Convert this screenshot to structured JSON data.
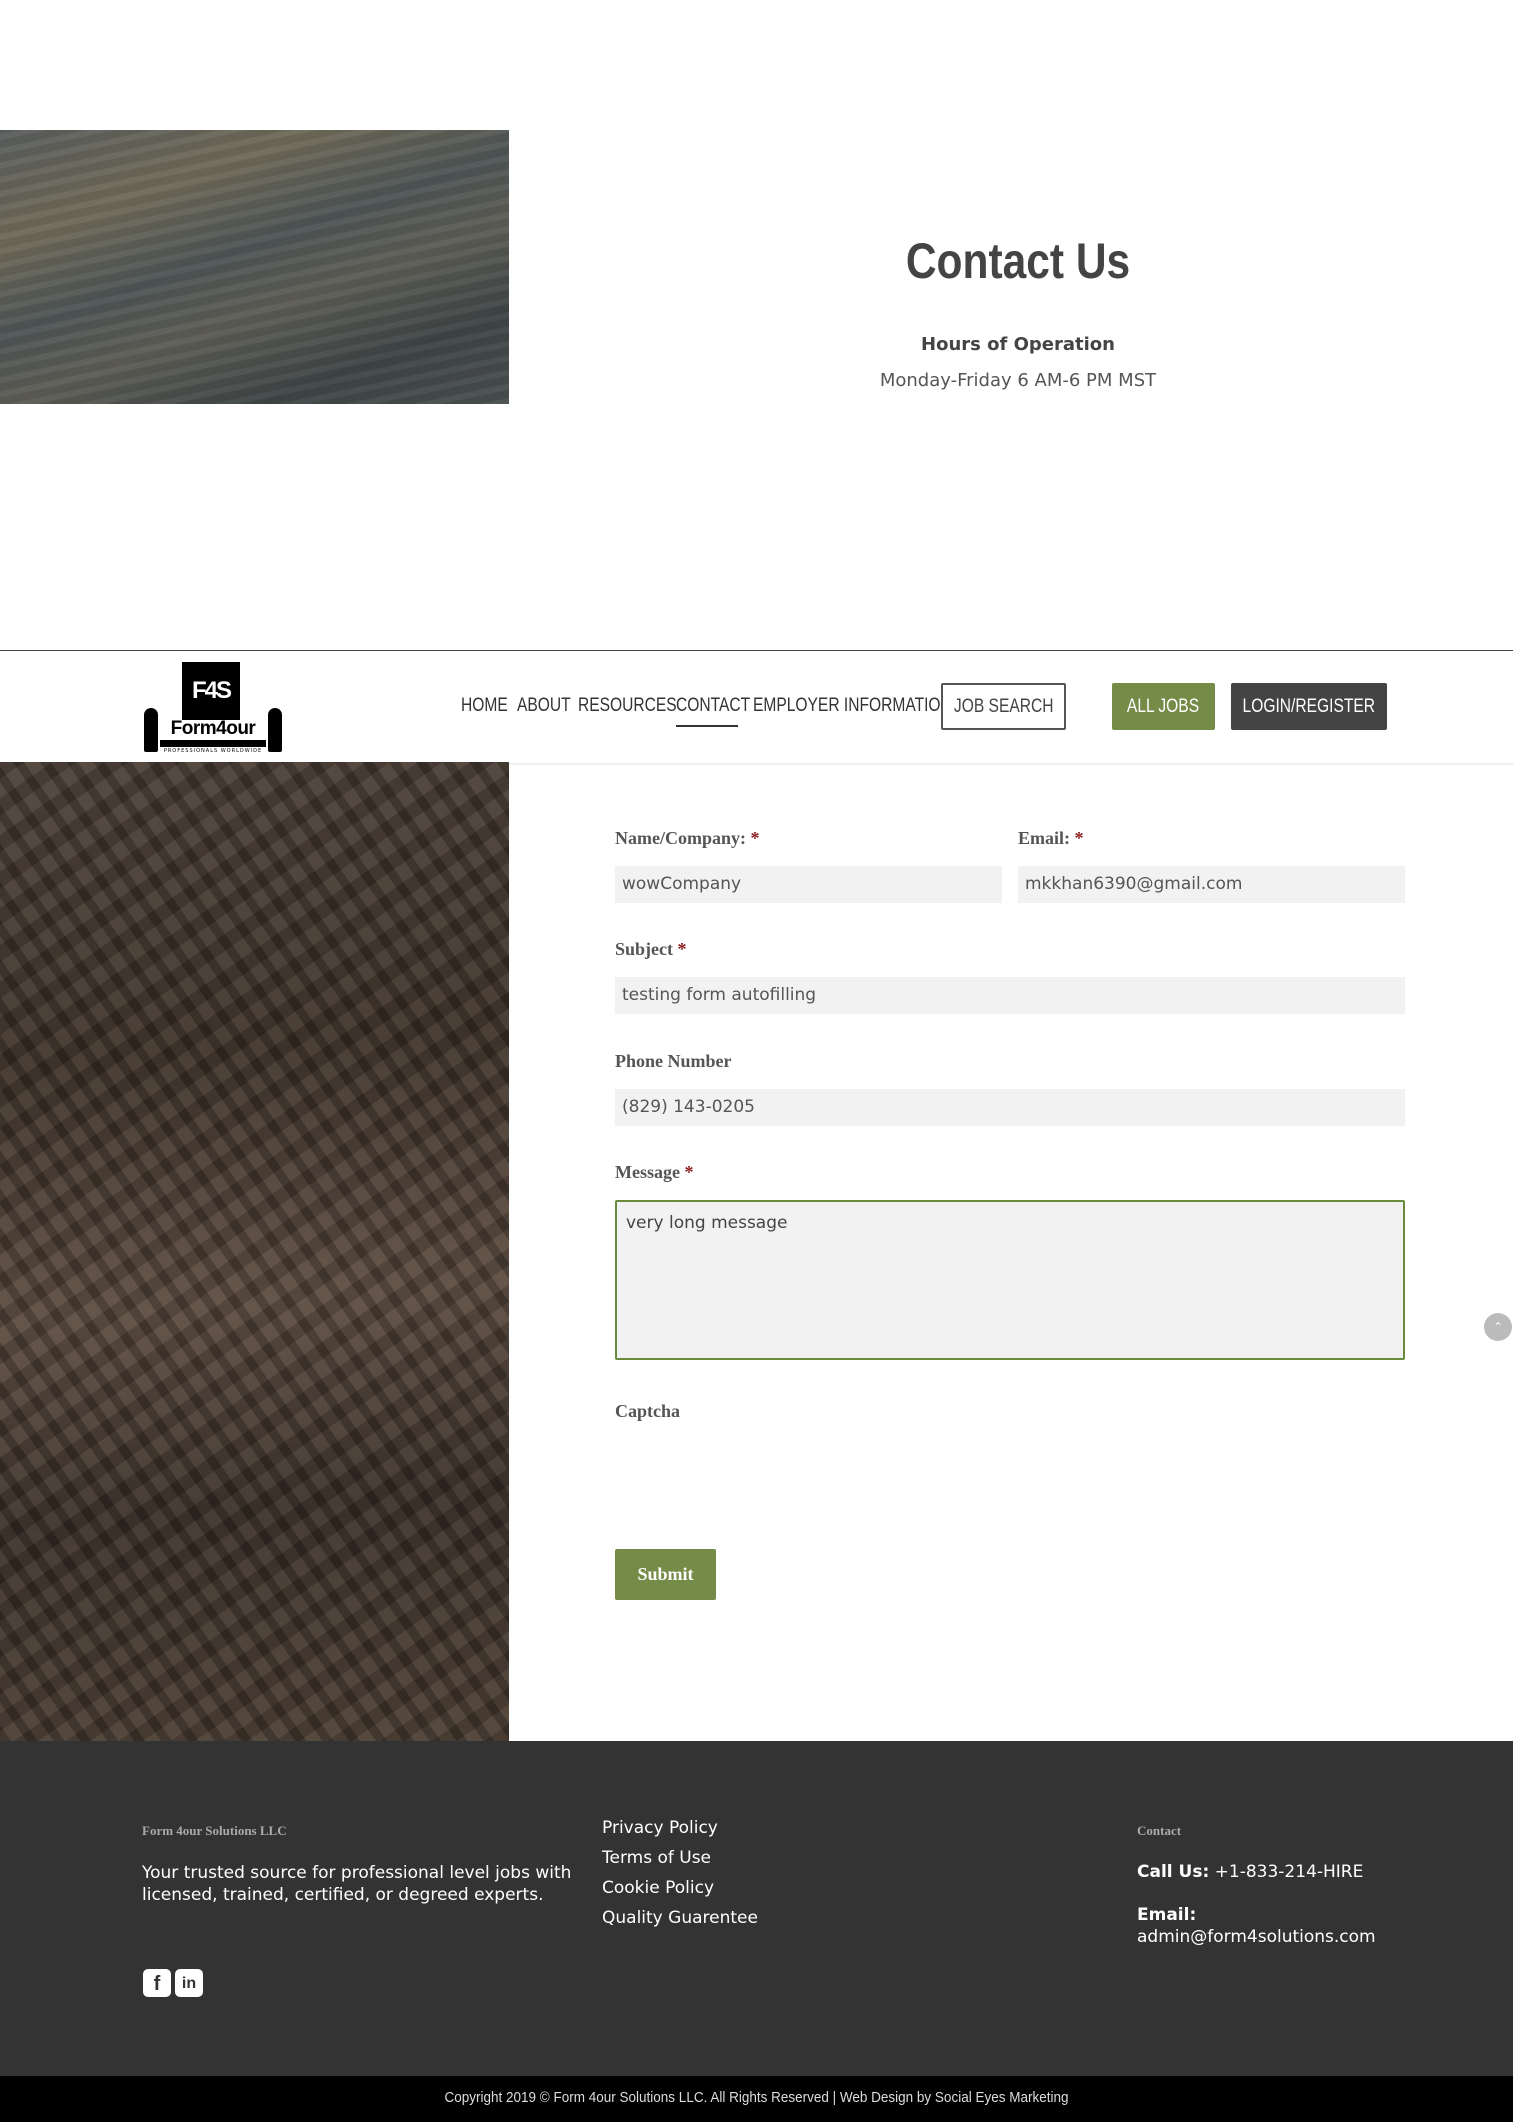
{
  "hero": {
    "title": "Contact Us",
    "hours_heading": "Hours of Operation",
    "hours_text": "Monday-Friday 6 AM-6 PM MST"
  },
  "header": {
    "logo": {
      "mark": "F4S",
      "wordmark": "Form4our",
      "sub": "PROFESSIONALS WORLDWIDE"
    },
    "nav": [
      {
        "label": "HOME"
      },
      {
        "label": "ABOUT"
      },
      {
        "label": "RESOURCES"
      },
      {
        "label": "CONTACT",
        "active": true
      },
      {
        "label": "EMPLOYER INFORMATION"
      }
    ],
    "buttons": {
      "job_search": "JOB SEARCH",
      "all_jobs": "ALL JOBS",
      "login": "LOGIN/REGISTER"
    }
  },
  "form": {
    "name_label": "Name/Company:",
    "name_value": "wowCompany",
    "email_label": "Email:",
    "email_value": "mkkhan6390@gmail.com",
    "subject_label": "Subject",
    "subject_value": "testing form autofilling",
    "phone_label": "Phone Number",
    "phone_value": "(829) 143-0205",
    "message_label": "Message",
    "message_value": "very long message",
    "captcha_label": "Captcha",
    "required_mark": "*",
    "submit_label": "Submit"
  },
  "footer": {
    "company": "Form 4our Solutions LLC",
    "tagline": "Your trusted source for professional level jobs with licensed, trained, certified, or degreed experts.",
    "social": [
      {
        "icon": "facebook-icon",
        "glyph": "f"
      },
      {
        "icon": "linkedin-icon",
        "glyph": "in"
      }
    ],
    "links": [
      "Privacy Policy",
      "Terms of Use",
      "Cookie Policy",
      "Quality Guarentee"
    ],
    "contact_title": "Contact",
    "call_label": "Call Us:",
    "call_value": "+1-833-214-HIRE",
    "email_label": "Email:",
    "email_value": "admin@form4solutions.com",
    "copyright": "Copyright 2019 © Form 4our Solutions LLC. All Rights Reserved | Web Design by Social Eyes Marketing"
  },
  "colors": {
    "accent_green": "#758b48",
    "dark_gray": "#444444",
    "footer_bg": "#333333"
  }
}
